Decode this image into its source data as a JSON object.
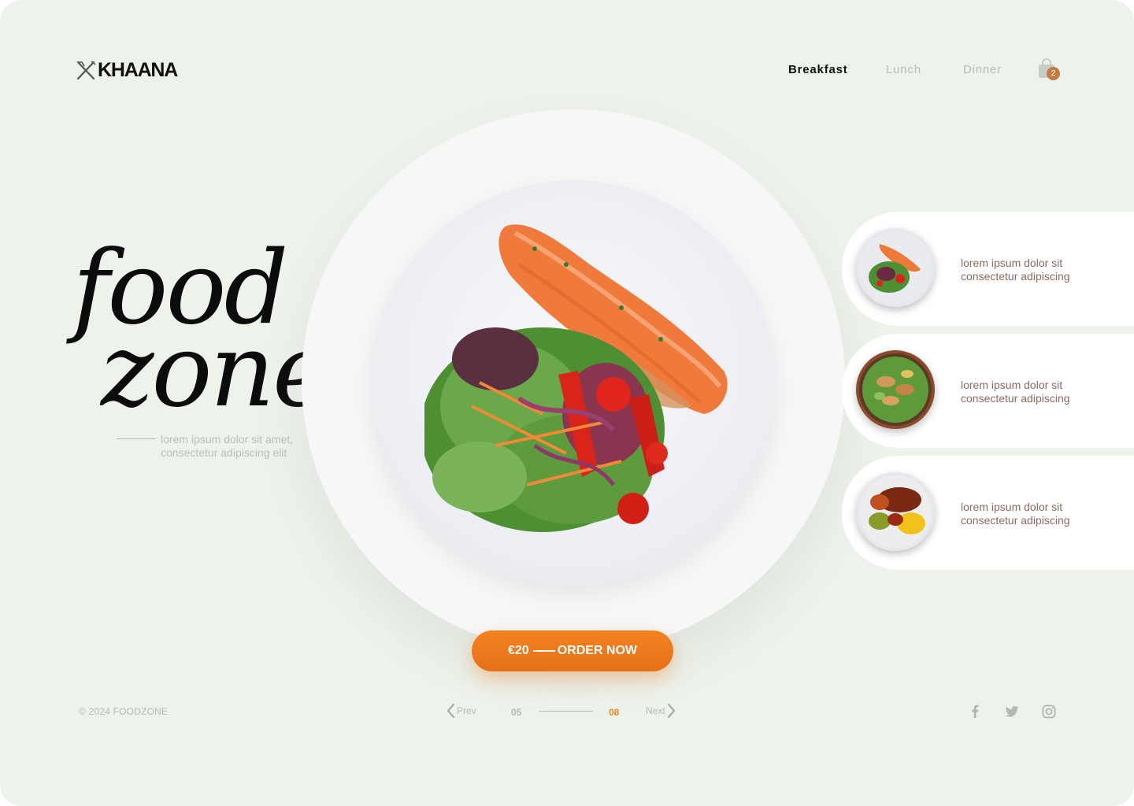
{
  "brand": {
    "name": "KHAANA",
    "icon": "fork-knife-icon"
  },
  "nav": {
    "items": [
      {
        "label": "Breakfast",
        "active": true
      },
      {
        "label": "Lunch",
        "active": false
      },
      {
        "label": "Dinner",
        "active": false
      }
    ]
  },
  "cart": {
    "icon": "shopping-bag-icon",
    "count": "2"
  },
  "hero": {
    "line1": "food",
    "line2": "zone",
    "subtitle_line1": "lorem ipsum dolor sit amet,",
    "subtitle_line2": "consectetur adipiscing elit"
  },
  "order": {
    "price": "€20",
    "label": "ORDER NOW"
  },
  "side_cards": [
    {
      "line1": "lorem ipsum dolor sit",
      "line2": "consectetur adipiscing"
    },
    {
      "line1": "lorem ipsum dolor sit",
      "line2": "consectetur adipiscing"
    },
    {
      "line1": "lorem ipsum dolor sit",
      "line2": "consectetur adipiscing"
    }
  ],
  "footer": {
    "copyright": "© 2024 FOODZONE",
    "pager": {
      "prev": "Prev",
      "next": "Next",
      "current": "05",
      "total": "08"
    },
    "social": [
      "facebook-icon",
      "twitter-icon",
      "instagram-icon"
    ]
  },
  "colors": {
    "background": "#edf2ea",
    "accent": "#f5821e",
    "muted": "#b5b9b3",
    "card_text": "#8a6a62"
  }
}
